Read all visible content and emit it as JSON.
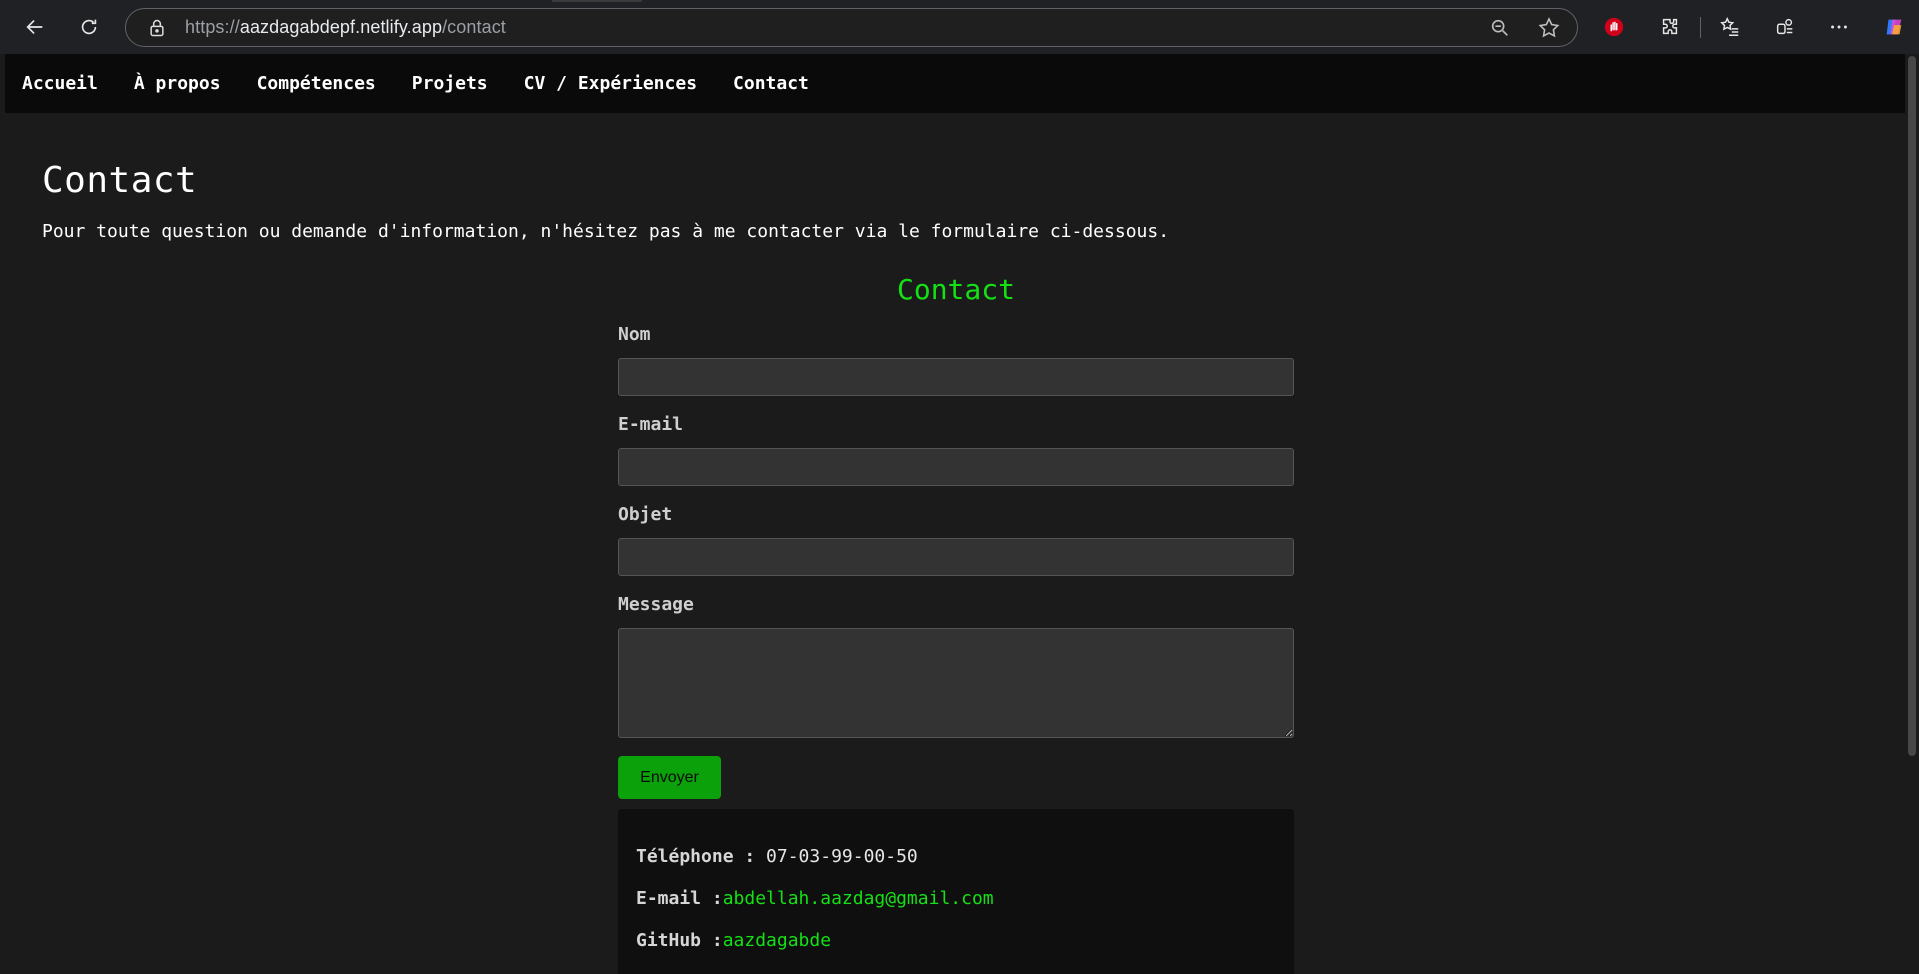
{
  "browser": {
    "url_scheme": "https://",
    "url_host": "aazdagabdepf.netlify.app",
    "url_path": "/contact"
  },
  "site_nav": {
    "items": [
      {
        "label": "Accueil"
      },
      {
        "label": "À propos"
      },
      {
        "label": "Compétences"
      },
      {
        "label": "Projets"
      },
      {
        "label": "CV / Expériences"
      },
      {
        "label": "Contact"
      }
    ]
  },
  "page": {
    "title": "Contact",
    "intro": "Pour toute question ou demande d'information, n'hésitez pas à me contacter via le formulaire ci-dessous."
  },
  "form": {
    "title": "Contact",
    "name_label": "Nom",
    "name_value": "",
    "email_label": "E-mail",
    "email_value": "",
    "subject_label": "Objet",
    "subject_value": "",
    "message_label": "Message",
    "message_value": "",
    "submit_label": "Envoyer"
  },
  "contact_info": {
    "phone_label": "Téléphone : ",
    "phone_value": "07-03-99-00-50",
    "email_label": "E-mail :",
    "email_value": "abdellah.aazdag@gmail.com",
    "github_label": "GitHub :",
    "github_value": "aazdagabde"
  },
  "colors": {
    "accent_green": "#14e114",
    "button_green": "#0aa10a",
    "nav_background": "#0a0a0a",
    "page_background": "#1b1b1b"
  }
}
